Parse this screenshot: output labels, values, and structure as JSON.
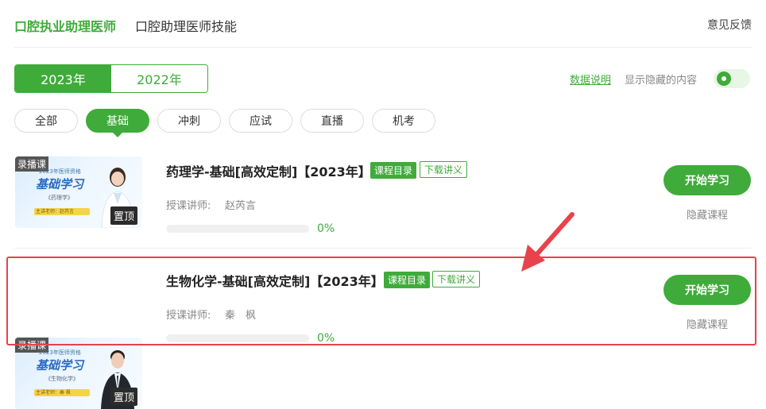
{
  "header": {
    "tabs": [
      {
        "label": "口腔执业助理医师"
      },
      {
        "label": "口腔助理医师技能"
      }
    ],
    "feedback": "意见反馈"
  },
  "years": [
    "2023年",
    "2022年"
  ],
  "data_link": "数据说明",
  "hidden_label": "显示隐藏的内容",
  "filters": [
    "全部",
    "基础",
    "冲刺",
    "应试",
    "直播",
    "机考"
  ],
  "courses": [
    {
      "thumb_tag": "录播课",
      "thumb_sub": "2023年医师资格",
      "thumb_title": "基础学习",
      "thumb_subject": "《药理学》",
      "thumb_strip": "主讲老师：赵芮言",
      "pin": "置顶",
      "title": "药理学-基础[高效定制]【2023年】",
      "badge_catalog": "课程目录",
      "badge_download": "下载讲义",
      "teacher_label": "授课讲师:",
      "teacher": "赵芮言",
      "progress": "0%",
      "start": "开始学习",
      "hide": "隐藏课程"
    },
    {
      "thumb_tag": "录播课",
      "thumb_sub": "2023年医师资格",
      "thumb_title": "基础学习",
      "thumb_subject": "《生物化学》",
      "thumb_strip": "主讲老师：秦 枫",
      "pin": "置顶",
      "title": "生物化学-基础[高效定制]【2023年】",
      "badge_catalog": "课程目录",
      "badge_download": "下载讲义",
      "teacher_label": "授课讲师:",
      "teacher": "秦　枫",
      "progress": "0%",
      "start": "开始学习",
      "hide": "隐藏课程"
    }
  ],
  "colors": {
    "accent": "#3fab3a",
    "highlight": "#e8424b"
  }
}
